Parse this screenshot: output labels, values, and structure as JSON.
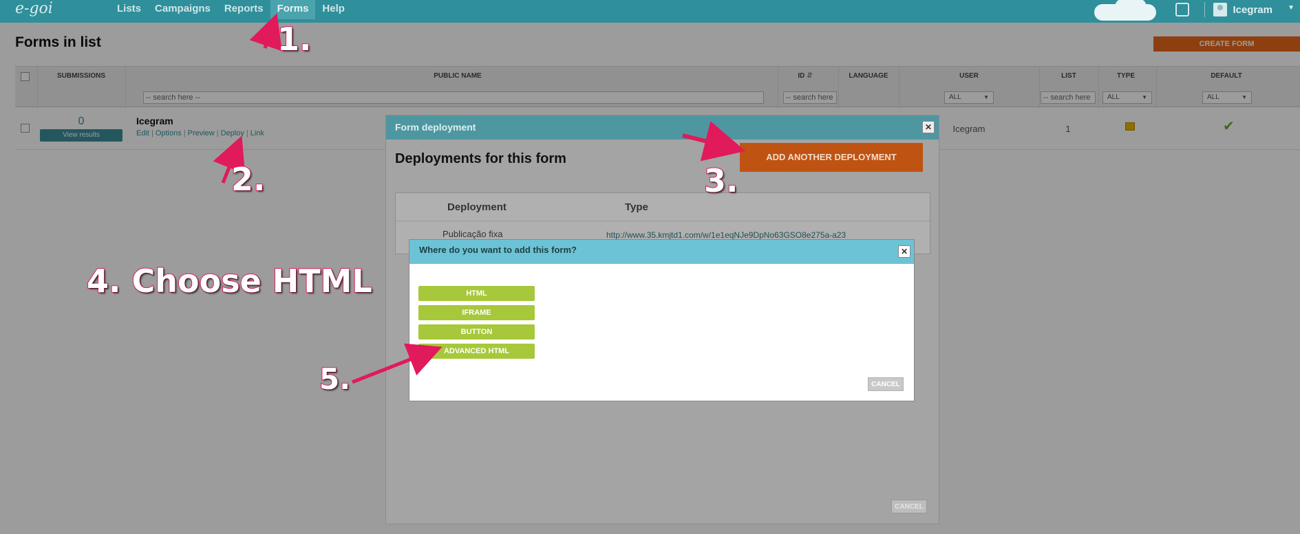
{
  "app": {
    "logo": "e-goi"
  },
  "nav": {
    "items": [
      "Lists",
      "Campaigns",
      "Reports",
      "Forms",
      "Help"
    ],
    "active": "Forms",
    "user_name": "Icegram"
  },
  "page": {
    "title": "Forms in list",
    "create_button": "CREATE FORM"
  },
  "table": {
    "headers": {
      "submissions": "SUBMISSIONS",
      "public_name": "PUBLIC NAME",
      "id": "ID",
      "language": "LANGUAGE",
      "user": "USER",
      "list": "LIST",
      "type": "TYPE",
      "default": "DEFAULT"
    },
    "filters": {
      "public_name_placeholder": "-- search here --",
      "id_placeholder": "-- search here",
      "user_select": "ALL",
      "list_placeholder": "-- search here",
      "type_select": "ALL",
      "default_select": "ALL"
    },
    "row": {
      "submissions": "0",
      "view_results": "View results",
      "name": "Icegram",
      "links": [
        "Edit",
        "Options",
        "Preview",
        "Deploy",
        "Link"
      ],
      "user": "Icegram",
      "list": "1"
    }
  },
  "deployment_modal": {
    "header": "Form deployment",
    "title": "Deployments for this form",
    "add_button": "ADD ANOTHER DEPLOYMENT",
    "columns": [
      "Deployment",
      "Type"
    ],
    "rows": [
      {
        "deployment": "Publicação fixa",
        "type": "http://www.35.kmjtd1.com/w/1e1eqNJe9DpNo63GSO8e275a-a23"
      }
    ],
    "cancel": "CANCEL"
  },
  "placement_modal": {
    "header": "Where do you want to add this form?",
    "options": [
      "HTML",
      "IFRAME",
      "BUTTON",
      "ADVANCED HTML"
    ],
    "cancel": "CANCEL"
  },
  "annotations": {
    "step1": "1.",
    "step2": "2.",
    "step3": "3.",
    "step4": "4. Choose HTML",
    "step5": "5."
  },
  "colors": {
    "nav_bg": "#2f8f9a",
    "accent_orange": "#e8671a",
    "option_green": "#a7c83a",
    "annotation_pink": "#e01a5b"
  },
  "icons": [
    "gear-icon",
    "user-avatar-icon",
    "sort-icon",
    "type-form-icon",
    "check-icon",
    "close-icon"
  ]
}
